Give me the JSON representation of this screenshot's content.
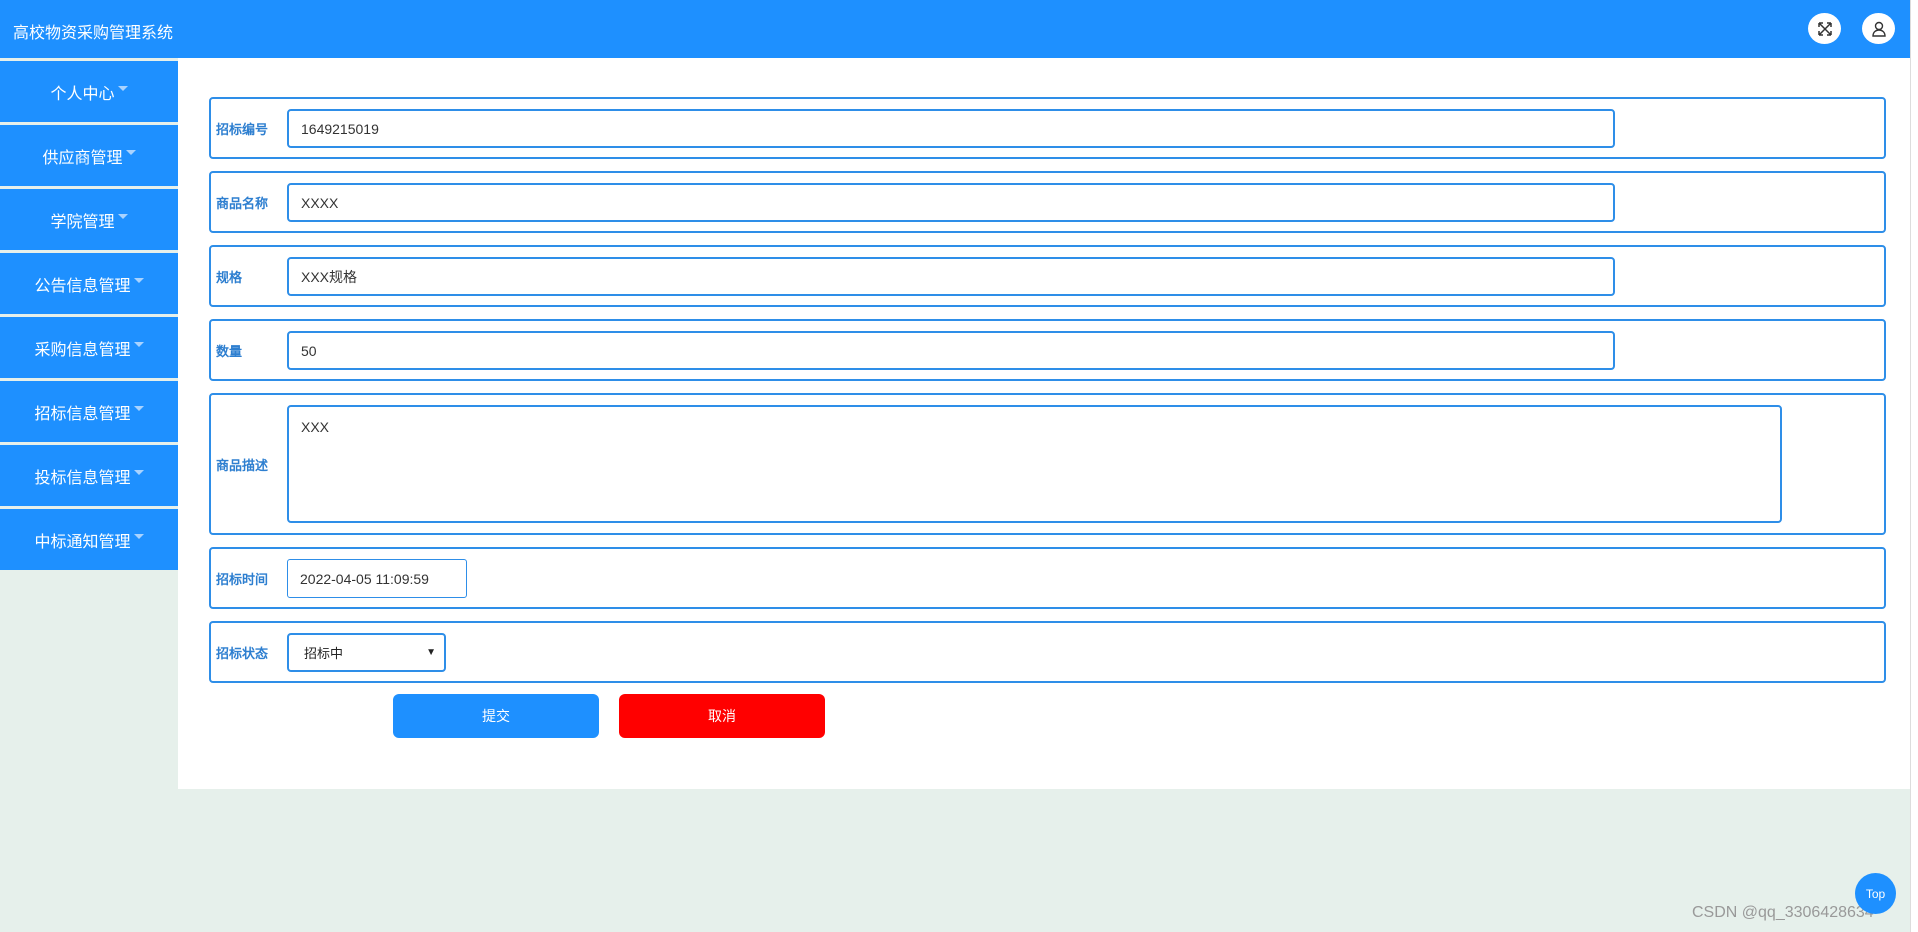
{
  "header": {
    "title": "高校物资采购管理系统",
    "icons": [
      "fullscreen-icon",
      "user-icon"
    ]
  },
  "sidebar": {
    "items": [
      {
        "label": "个人中心"
      },
      {
        "label": "供应商管理"
      },
      {
        "label": "学院管理"
      },
      {
        "label": "公告信息管理"
      },
      {
        "label": "采购信息管理"
      },
      {
        "label": "招标信息管理"
      },
      {
        "label": "投标信息管理"
      },
      {
        "label": "中标通知管理"
      }
    ]
  },
  "form": {
    "bid_no": {
      "label": "招标编号",
      "value": "1649215019"
    },
    "product_name": {
      "label": "商品名称",
      "value": "XXXX"
    },
    "spec": {
      "label": "规格",
      "value": "XXX规格"
    },
    "quantity": {
      "label": "数量",
      "value": "50"
    },
    "description": {
      "label": "商品描述",
      "value": "XXX"
    },
    "bid_time": {
      "label": "招标时间",
      "value": "2022-04-05 11:09:59"
    },
    "status": {
      "label": "招标状态",
      "value": "招标中"
    },
    "submit_label": "提交",
    "cancel_label": "取消"
  },
  "colors": {
    "primary": "#1e90ff",
    "cancel": "#ff0000"
  },
  "top_label": "Top",
  "watermark": "CSDN @qq_3306428634"
}
